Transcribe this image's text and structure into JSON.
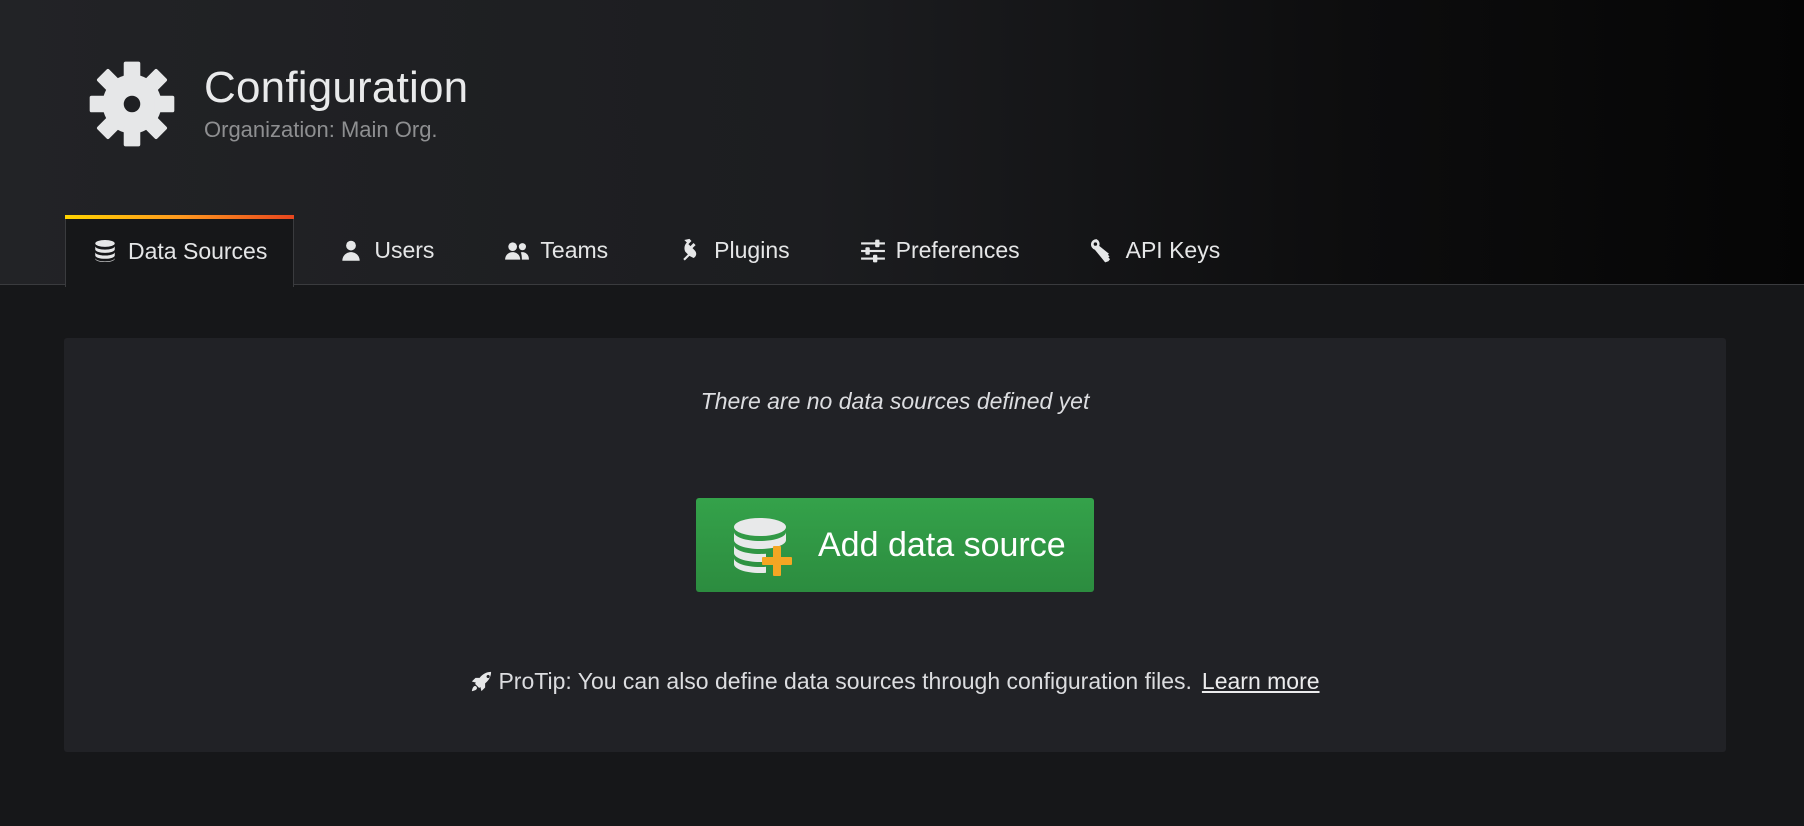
{
  "header": {
    "title": "Configuration",
    "subtitle": "Organization: Main Org.",
    "icon": "gear-icon"
  },
  "tabs": [
    {
      "label": "Data Sources",
      "icon": "database-icon",
      "active": true
    },
    {
      "label": "Users",
      "icon": "user-icon",
      "active": false
    },
    {
      "label": "Teams",
      "icon": "team-icon",
      "active": false
    },
    {
      "label": "Plugins",
      "icon": "plug-icon",
      "active": false
    },
    {
      "label": "Preferences",
      "icon": "sliders-icon",
      "active": false
    },
    {
      "label": "API Keys",
      "icon": "key-icon",
      "active": false
    }
  ],
  "empty_state": {
    "message": "There are no data sources defined yet",
    "button_label": "Add data source",
    "button_icon": "database-add-icon",
    "protip_text": "ProTip: You can also define data sources through configuration files.",
    "protip_icon": "rocket-icon",
    "learn_more": "Learn more"
  },
  "colors": {
    "accent_gradient": [
      "#ffd400",
      "#ff9a1f",
      "#e8461e"
    ],
    "button_green": "#34a24a",
    "background": "#161719",
    "panel": "#212226"
  }
}
